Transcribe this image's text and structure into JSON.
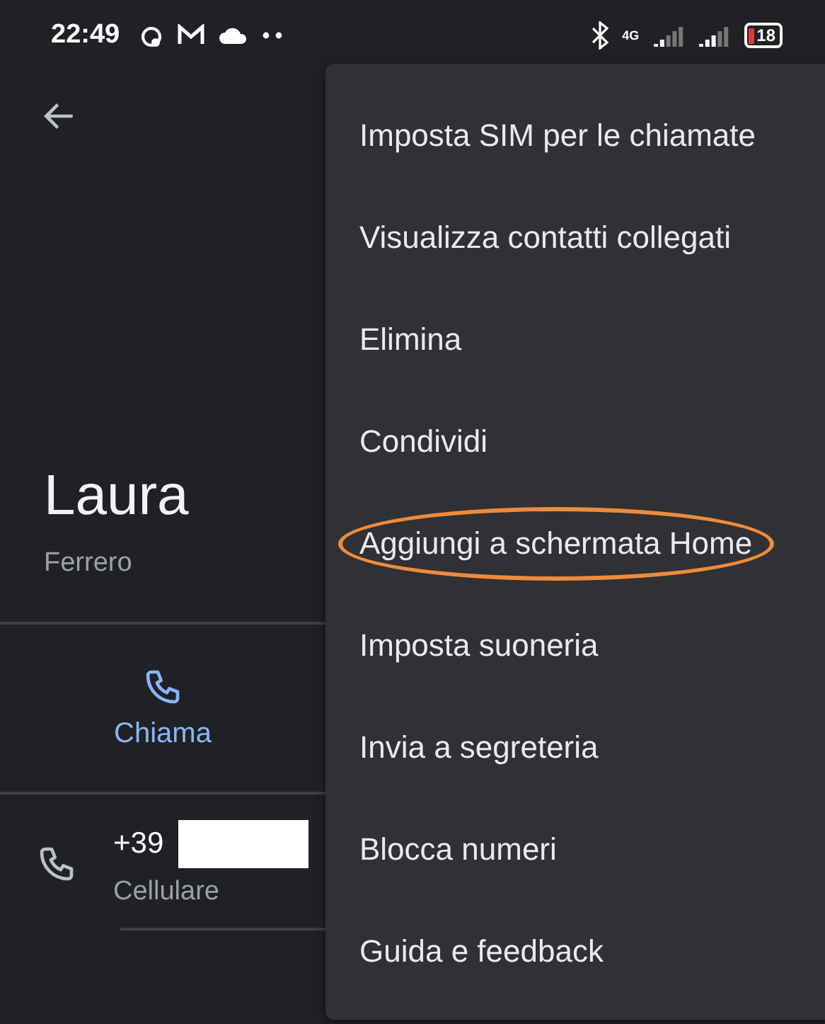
{
  "status_bar": {
    "time": "22:49",
    "network_label": "4G",
    "battery": "18"
  },
  "contact": {
    "first_name": "Laura",
    "last_name": "Ferrero",
    "action": "Chiama",
    "phone_prefix": "+39",
    "phone_type": "Cellulare"
  },
  "menu": [
    {
      "label": "Imposta SIM per le chiamate",
      "circled": false
    },
    {
      "label": "Visualizza contatti collegati",
      "circled": false
    },
    {
      "label": "Elimina",
      "circled": false
    },
    {
      "label": "Condividi",
      "circled": false
    },
    {
      "label": "Aggiungi a schermata Home",
      "circled": true
    },
    {
      "label": "Imposta suoneria",
      "circled": false
    },
    {
      "label": "Invia a segreteria",
      "circled": false
    },
    {
      "label": "Blocca numeri",
      "circled": false
    },
    {
      "label": "Guida e feedback",
      "circled": false
    }
  ]
}
